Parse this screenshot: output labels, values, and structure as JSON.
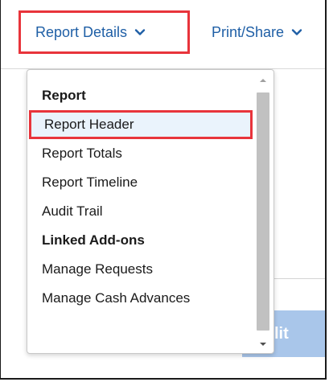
{
  "toolbar": {
    "report_details_label": "Report Details",
    "print_share_label": "Print/Share"
  },
  "background": {
    "button_fragment": "lit"
  },
  "menu": {
    "section_report": "Report",
    "items_report": [
      "Report Header",
      "Report Totals",
      "Report Timeline",
      "Audit Trail"
    ],
    "section_addons": "Linked Add-ons",
    "items_addons": [
      "Manage Requests",
      "Manage Cash Advances"
    ],
    "highlighted_item": "Report Header"
  },
  "colors": {
    "link_blue": "#1f5fa6",
    "highlight_red": "#e8343b",
    "button_light_blue": "#a9c6ea",
    "scroll_thumb": "#c1c1c1"
  },
  "icons": {
    "dropdown": "chevron-down-icon",
    "scroll_up": "scroll-up-arrow-icon",
    "scroll_down": "scroll-down-arrow-icon"
  }
}
